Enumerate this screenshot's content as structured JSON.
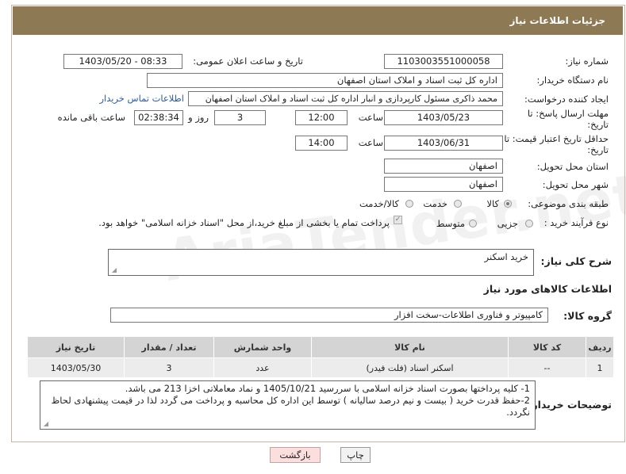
{
  "header": {
    "title": "جزئیات اطلاعات نیاز"
  },
  "fields": {
    "need_number_label": "شماره نیاز:",
    "need_number": "1103003551000058",
    "announce_label": "تاریخ و ساعت اعلان عمومی:",
    "announce_value": "1403/05/20 - 08:33",
    "buyer_org_label": "نام دستگاه خریدار:",
    "buyer_org": "اداره کل ثبت اسناد و املاک استان اصفهان",
    "requester_label": "ایجاد کننده درخواست:",
    "requester": "محمد ذاکری مسئول کارپردازی و انبار اداره کل ثبت اسناد و املاک استان اصفهان",
    "contact_link": "اطلاعات تماس خریدار",
    "deadline_label_1": "مهلت ارسال پاسخ: تا",
    "deadline_label_2": "تاریخ:",
    "deadline_date": "1403/05/23",
    "time_label": "ساعت",
    "deadline_time": "12:00",
    "days_value": "3",
    "days_label": "روز و",
    "remaining_value": "02:38:34",
    "remaining_label": "ساعت باقی مانده",
    "validity_label_1": "حداقل تاریخ اعتبار قیمت: تا",
    "validity_label_2": "تاریخ:",
    "validity_date": "1403/06/31",
    "validity_time_label": "ساعت",
    "validity_time": "14:00",
    "province_label": "استان محل تحویل:",
    "province": "اصفهان",
    "city_label": "شهر محل تحویل:",
    "city": "اصفهان",
    "category_label": "طبقه بندی موضوعی:",
    "category_options": [
      "کالا",
      "خدمت",
      "کالا/خدمت"
    ],
    "category_selected": "کالا",
    "process_label": "نوع فرآیند خرید :",
    "process_options": [
      "جزیی",
      "متوسط"
    ],
    "payment_note": "پرداخت تمام یا بخشی از مبلغ خرید،از محل \"اسناد خزانه اسلامی\" خواهد بود."
  },
  "general_desc": {
    "label": "شرح کلی نیاز:",
    "value": "خرید اسکنر"
  },
  "goods_section": {
    "title": "اطلاعات کالاهای مورد نیاز"
  },
  "goods_group": {
    "label": "گروه کالا:",
    "value": "کامپیوتر و فناوری اطلاعات-سخت افزار"
  },
  "table": {
    "headers": [
      "ردیف",
      "کد کالا",
      "نام کالا",
      "واحد شمارش",
      "تعداد / مقدار",
      "تاریخ نیاز"
    ],
    "rows": [
      [
        "1",
        "--",
        "اسکنر اسناد (فلت فیدر)",
        "عدد",
        "3",
        "1403/05/30"
      ]
    ]
  },
  "buyer_notes": {
    "label": "توضیحات خریدار:",
    "line1": "1- کلیه پرداختها بصورت اسناد خزانه اسلامی با سررسید 1405/10/21 و نماد معاملاتی اخزا 213 می باشد.",
    "line2": "2-حفظ قدرت خرید ( بیست و نیم درصد سالیانه ) توسط این اداره کل محاسبه و پرداخت می گردد لذا در قیمت پیشنهادی لحاظ نگردد."
  },
  "buttons": {
    "print": "چاپ",
    "back": "بازگشت"
  },
  "watermark": "AriaTender.net"
}
